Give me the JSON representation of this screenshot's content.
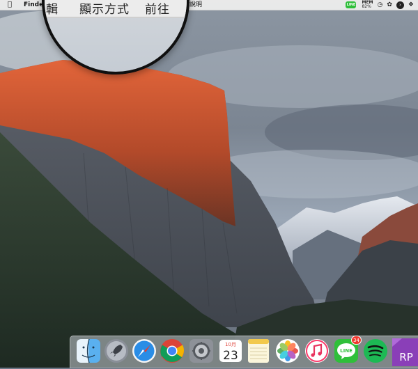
{
  "menubar": {
    "apple_icon": "apple-icon",
    "app_name": "Finder",
    "help_menu": "說明",
    "tray": {
      "line_label": "LINE",
      "mem_label": "MEM",
      "mem_value": "82%",
      "icons": [
        "line-icon",
        "clock-icon",
        "control-icon",
        "chevron-icon",
        "evernote-icon"
      ]
    }
  },
  "magnifier": {
    "items": [
      "輯",
      "顯示方式",
      "前往"
    ]
  },
  "dock": {
    "items": [
      {
        "name": "finder"
      },
      {
        "name": "launchpad"
      },
      {
        "name": "safari"
      },
      {
        "name": "chrome"
      },
      {
        "name": "system-preferences"
      },
      {
        "name": "calendar",
        "month": "10月",
        "day": "23"
      },
      {
        "name": "notes"
      },
      {
        "name": "photos"
      },
      {
        "name": "itunes"
      },
      {
        "name": "line",
        "label": "LINE",
        "badge": "34"
      },
      {
        "name": "spotify"
      },
      {
        "name": "rp",
        "label": "RP"
      }
    ]
  },
  "colors": {
    "menubar": "#ececec",
    "line_green": "#2fbf3a",
    "badge_red": "#f03a2f",
    "spotify_green": "#1db954",
    "rp_purple": "#8a3fb8"
  }
}
